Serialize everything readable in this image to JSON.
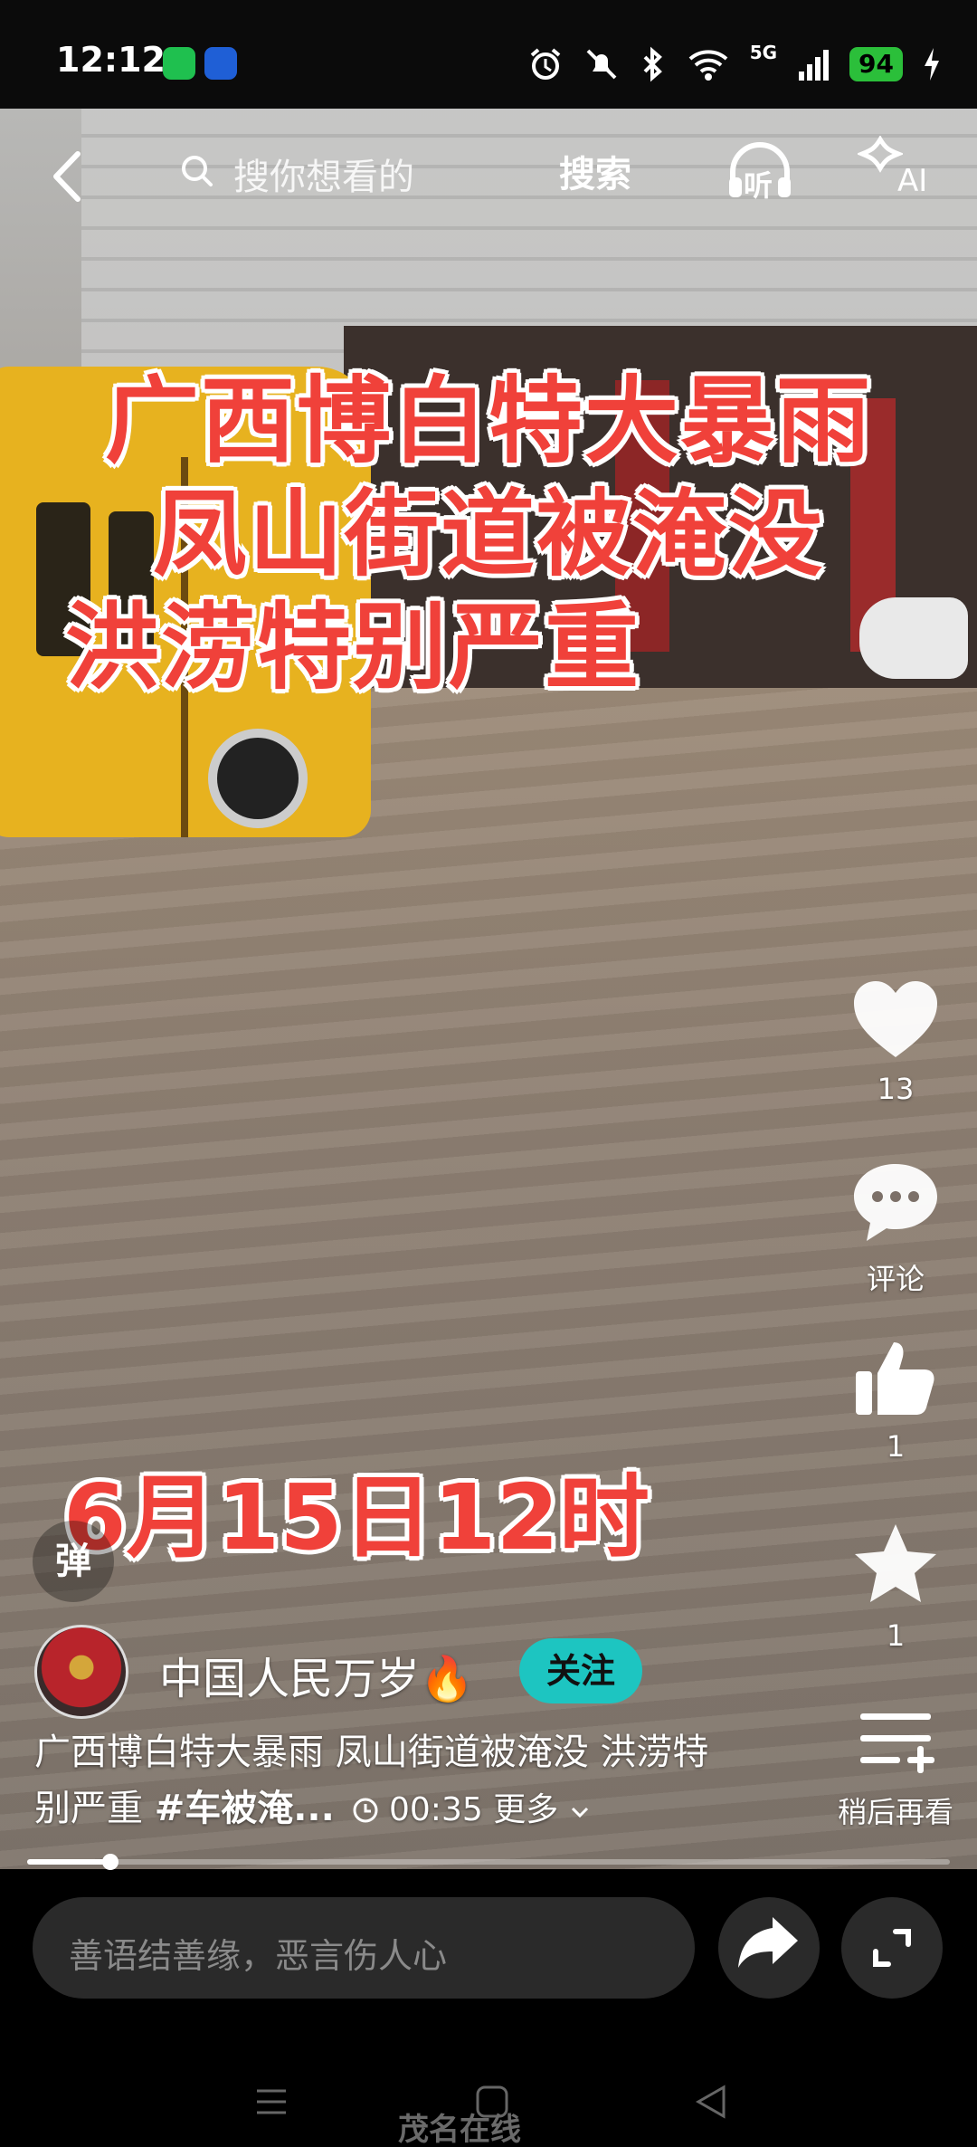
{
  "status_bar": {
    "time": "12:12",
    "signal_label": "5G",
    "battery": "94"
  },
  "top_nav": {
    "search_placeholder": "搜你想看的",
    "search_button": "搜索",
    "listen_label": "听",
    "ai_label": "AI"
  },
  "video": {
    "title_lines": [
      "广西博白特大暴雨",
      "凤山街道被淹没",
      "洪涝特别严重"
    ],
    "date_overlay": "6月15日12时",
    "progress_fraction": 0.09
  },
  "actions": {
    "like_count": "13",
    "comment_label": "评论",
    "thumb_count": "1",
    "favorite_count": "1",
    "watch_later_label": "稍后再看"
  },
  "danmu_label": "弹",
  "author": {
    "name": "中国人民万岁🔥",
    "follow_label": "关注"
  },
  "description": {
    "text": "广西博白特大暴雨 凤山街道被淹没 洪涝特别严重 ",
    "tag": "#车被淹...",
    "duration": "00:35",
    "more": "更多"
  },
  "bottom": {
    "comment_placeholder": "善语结善缘，恶言伤人心"
  },
  "watermark": "茂名在线"
}
